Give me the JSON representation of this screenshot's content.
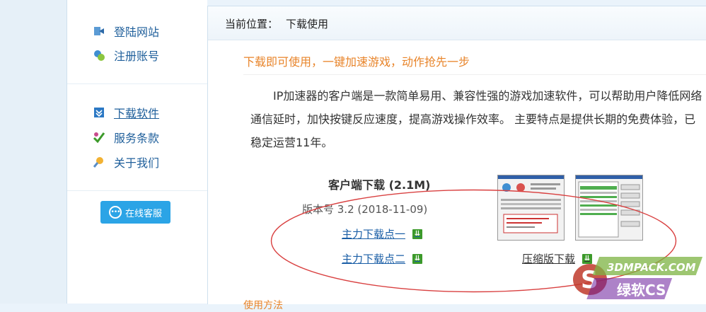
{
  "sidebar": {
    "items": [
      {
        "label": "登陆网站",
        "icon": "login-icon"
      },
      {
        "label": "注册账号",
        "icon": "register-icon"
      },
      {
        "label": "下载软件",
        "icon": "download-icon"
      },
      {
        "label": "服务条款",
        "icon": "terms-icon"
      },
      {
        "label": "关于我们",
        "icon": "about-icon"
      }
    ],
    "chat_button": {
      "label": "在线客服",
      "icon": "chat-bubble-icon"
    }
  },
  "breadcrumb": {
    "label": "当前位置：",
    "current": "下载使用"
  },
  "main": {
    "title": "下载即可使用，一键加速游戏，动作抢先一步",
    "description": "IP加速器的客户端是一款简单易用、兼容性强的游戏加速软件，可以帮助用户降低网络通信延时，加快按键反应速度，提高游戏操作效率。 主要特点是提供长期的免费体验，已稳定运营11年。",
    "download_title": "客户端下载 (2.1M)",
    "version": "版本号 3.2 (2018-11-09)",
    "links": [
      "主力下载点一",
      "主力下载点二",
      "压缩版下载"
    ],
    "peek_text": "使用方法"
  },
  "colors": {
    "accent": "#2ba4e6",
    "orange": "#e8842a",
    "link": "#1a5ea6",
    "download_badge": "#3c9a2a",
    "annotation": "#d94040"
  },
  "watermark": {
    "top": "3DMPACK.COM",
    "bottom": "绿软CS"
  }
}
